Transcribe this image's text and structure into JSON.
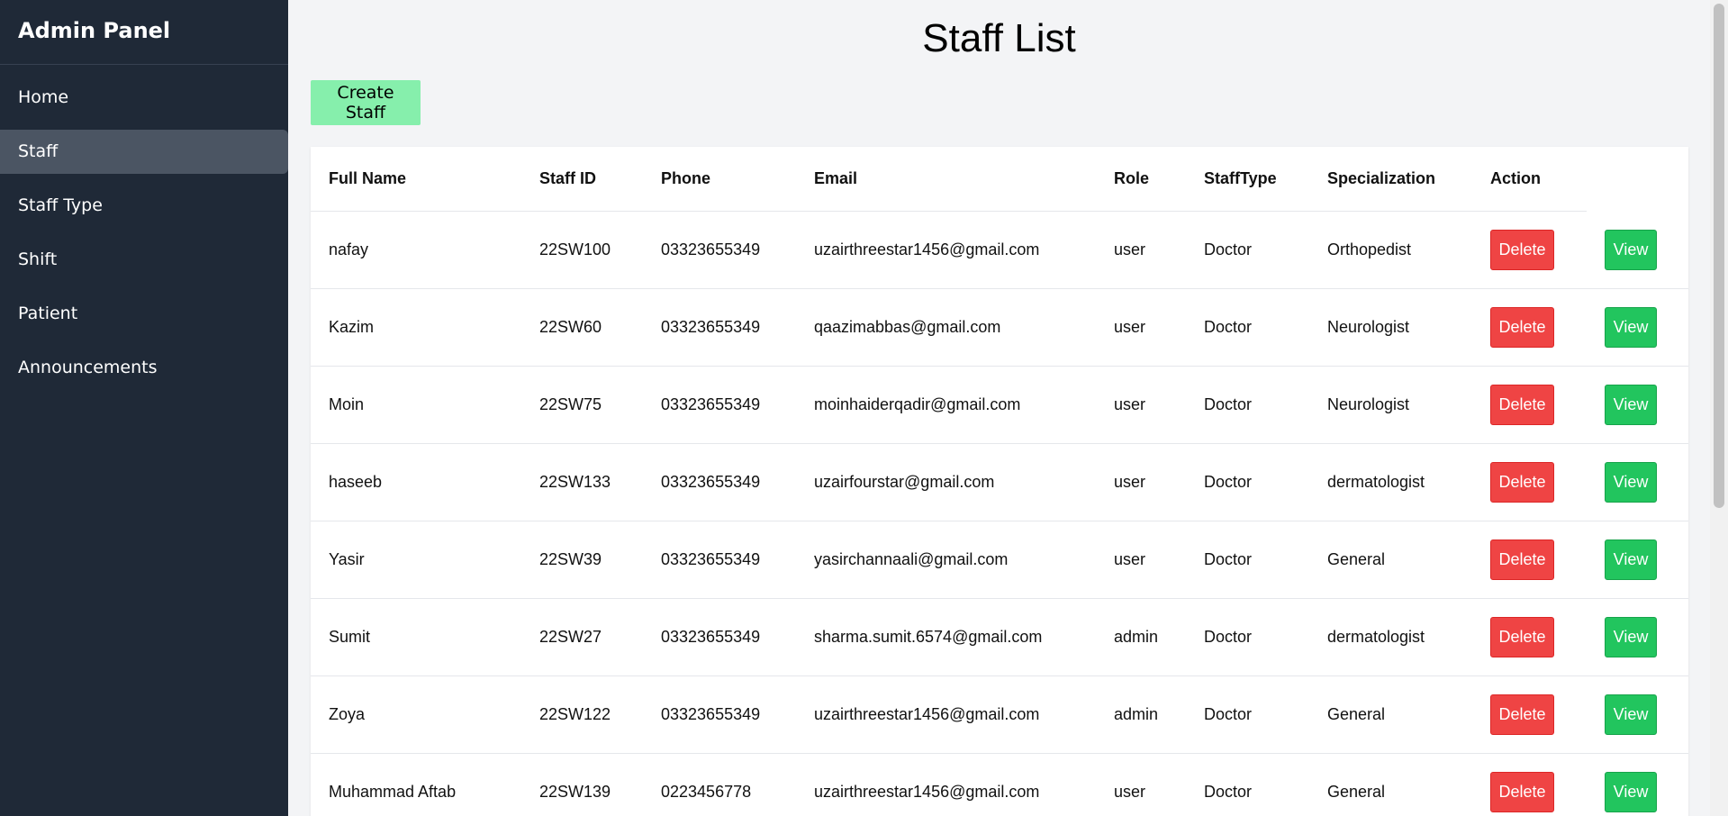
{
  "sidebar": {
    "title": "Admin Panel",
    "items": [
      "Home",
      "Staff",
      "Staff Type",
      "Shift",
      "Patient",
      "Announcements"
    ],
    "active": "Staff"
  },
  "main": {
    "title": "Staff List",
    "create_button": "Create Staff"
  },
  "table": {
    "columns": [
      "Full Name",
      "Staff ID",
      "Phone",
      "Email",
      "Role",
      "StaffType",
      "Specialization",
      "Action"
    ],
    "rows": [
      [
        "nafay",
        "22SW100",
        "03323655349",
        "uzairthreestar1456@gmail.com",
        "user",
        "Doctor",
        "Orthopedist"
      ],
      [
        "Kazim",
        "22SW60",
        "03323655349",
        "qaazimabbas@gmail.com",
        "user",
        "Doctor",
        "Neurologist"
      ],
      [
        "Moin",
        "22SW75",
        "03323655349",
        "moinhaiderqadir@gmail.com",
        "user",
        "Doctor",
        "Neurologist"
      ],
      [
        "haseeb",
        "22SW133",
        "03323655349",
        "uzairfourstar@gmail.com",
        "user",
        "Doctor",
        "dermatologist"
      ],
      [
        "Yasir",
        "22SW39",
        "03323655349",
        "yasirchannaali@gmail.com",
        "user",
        "Doctor",
        "General"
      ],
      [
        "Sumit",
        "22SW27",
        "03323655349",
        "sharma.sumit.6574@gmail.com",
        "admin",
        "Doctor",
        "dermatologist"
      ],
      [
        "Zoya",
        "22SW122",
        "03323655349",
        "uzairthreestar1456@gmail.com",
        "admin",
        "Doctor",
        "General"
      ],
      [
        "Muhammad Aftab",
        "22SW139",
        "0223456778",
        "uzairthreestar1456@gmail.com",
        "user",
        "Doctor",
        "General"
      ]
    ],
    "delete_label": "Delete",
    "view_label": "View"
  },
  "colors": {
    "sidebar_bg": "#1f2937",
    "active_item_bg": "#4b5563",
    "create_button": "#86efac",
    "delete_button": "#ef4444",
    "view_button": "#22c55e"
  }
}
